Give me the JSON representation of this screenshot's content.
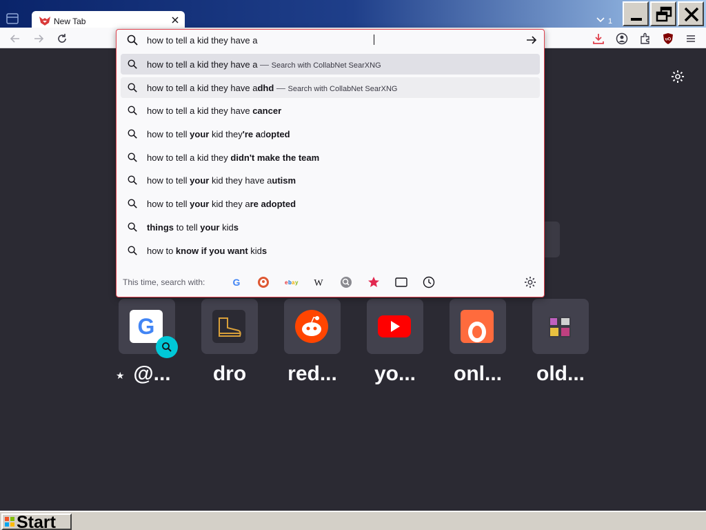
{
  "window": {
    "tab_title": "New Tab",
    "tabs_count": "1"
  },
  "urlbar": {
    "value": "how to tell a kid they have a",
    "suggestions": [
      {
        "parts": [
          [
            "how to tell a kid they have a",
            false
          ]
        ],
        "action": "Search with CollabNet SearXNG",
        "state": "selected"
      },
      {
        "parts": [
          [
            "how to tell a kid they have ",
            false
          ],
          [
            "a",
            false
          ],
          [
            "dhd",
            true
          ]
        ],
        "action": "Search with CollabNet SearXNG",
        "state": "hover"
      },
      {
        "parts": [
          [
            "how to tell a kid they have ",
            false
          ],
          [
            "cancer",
            true
          ]
        ]
      },
      {
        "parts": [
          [
            "how to tell ",
            false
          ],
          [
            "your",
            true
          ],
          [
            " kid they",
            false
          ],
          [
            "'re a",
            true
          ],
          [
            "d",
            false
          ],
          [
            "opted",
            true
          ]
        ]
      },
      {
        "parts": [
          [
            "how to tell a kid they ",
            false
          ],
          [
            "didn't make the team",
            true
          ]
        ]
      },
      {
        "parts": [
          [
            "how to tell ",
            false
          ],
          [
            "your",
            true
          ],
          [
            " kid they have a",
            false
          ],
          [
            "utism",
            true
          ]
        ]
      },
      {
        "parts": [
          [
            "how to tell ",
            false
          ],
          [
            "your",
            true
          ],
          [
            " kid they a",
            false
          ],
          [
            "re adopted",
            true
          ]
        ]
      },
      {
        "parts": [
          [
            "things",
            true
          ],
          [
            " to tell ",
            false
          ],
          [
            "your",
            true
          ],
          [
            " kid",
            false
          ],
          [
            "s",
            true
          ]
        ]
      },
      {
        "parts": [
          [
            "how to ",
            false
          ],
          [
            "know if you want",
            true
          ],
          [
            " kid",
            false
          ],
          [
            "s",
            true
          ]
        ]
      }
    ],
    "engines_label": "This time, search with:",
    "engines": [
      "google-icon",
      "duckduckgo-icon",
      "ebay-icon",
      "wikipedia-icon",
      "searxng-icon",
      "bookmarks-icon",
      "tabs-icon",
      "history-icon"
    ]
  },
  "top_sites": [
    {
      "label": " @...",
      "icon": "google-icon"
    },
    {
      "label": "dro",
      "icon": "boot-icon"
    },
    {
      "label": "red...",
      "icon": "reddit-icon"
    },
    {
      "label": "yo...",
      "icon": "youtube-icon"
    },
    {
      "label": "onl...",
      "icon": "onlyfans-icon"
    },
    {
      "label": "old...",
      "icon": "oldsite-icon"
    }
  ],
  "taskbar": {
    "start_label": "Start"
  },
  "colors": {
    "accent": "#e0424e",
    "page_bg": "#2b2a33",
    "tile_bg": "#42414d"
  }
}
